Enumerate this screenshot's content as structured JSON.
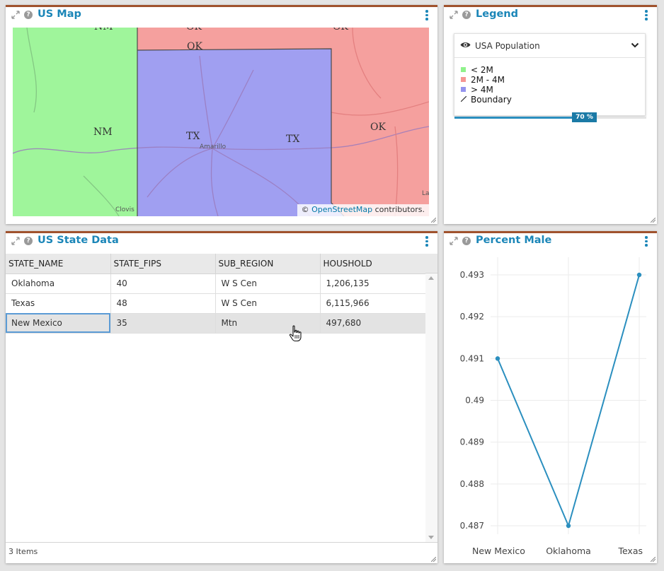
{
  "panels": {
    "map": {
      "title": "US Map",
      "labels": {
        "nm_top": "NM",
        "ok_top1": "OK",
        "ok_top2": "OK",
        "ok_mid": "OK",
        "nm": "NM",
        "tx1": "TX",
        "tx2": "TX",
        "ok_right": "OK",
        "amarillo": "Amarillo",
        "clovis": "Clovis",
        "la": "La"
      },
      "attribution": {
        "prefix": "©",
        "link": "OpenStreetMap",
        "suffix": "contributors."
      },
      "colors": {
        "low": "#9ff59b",
        "mid": "#f5a09e",
        "high": "#a09ff1",
        "boundary": "#4a4a4a"
      }
    },
    "legend": {
      "title": "Legend",
      "layer_name": "USA Population",
      "items": [
        {
          "label": "< 2M",
          "color": "#8ff28b"
        },
        {
          "label": "2M - 4M",
          "color": "#f59693"
        },
        {
          "label": "> 4M",
          "color": "#9493ee"
        }
      ],
      "boundary_label": "Boundary",
      "opacity_label": "70 %",
      "opacity_value": 0.7
    },
    "table": {
      "title": "US State Data",
      "columns": [
        "STATE_NAME",
        "STATE_FIPS",
        "SUB_REGION",
        "HOUSHOLD"
      ],
      "rows": [
        [
          "Oklahoma",
          "40",
          "W S Cen",
          "1,206,135"
        ],
        [
          "Texas",
          "48",
          "W S Cen",
          "6,115,966"
        ],
        [
          "New Mexico",
          "35",
          "Mtn",
          "497,680"
        ]
      ],
      "footer": "3 Items"
    },
    "chart": {
      "title": "Percent Male"
    }
  },
  "chart_data": {
    "type": "line",
    "title": "Percent Male",
    "categories": [
      "New Mexico",
      "Oklahoma",
      "Texas"
    ],
    "series": [
      {
        "values": [
          0.491,
          0.487,
          0.493
        ]
      }
    ],
    "yticks": [
      "0.487",
      "0.488",
      "0.489",
      "0.49",
      "0.491",
      "0.492",
      "0.493"
    ],
    "ylim": [
      0.487,
      0.493
    ],
    "grid": true,
    "color": "#2b8fbf"
  }
}
